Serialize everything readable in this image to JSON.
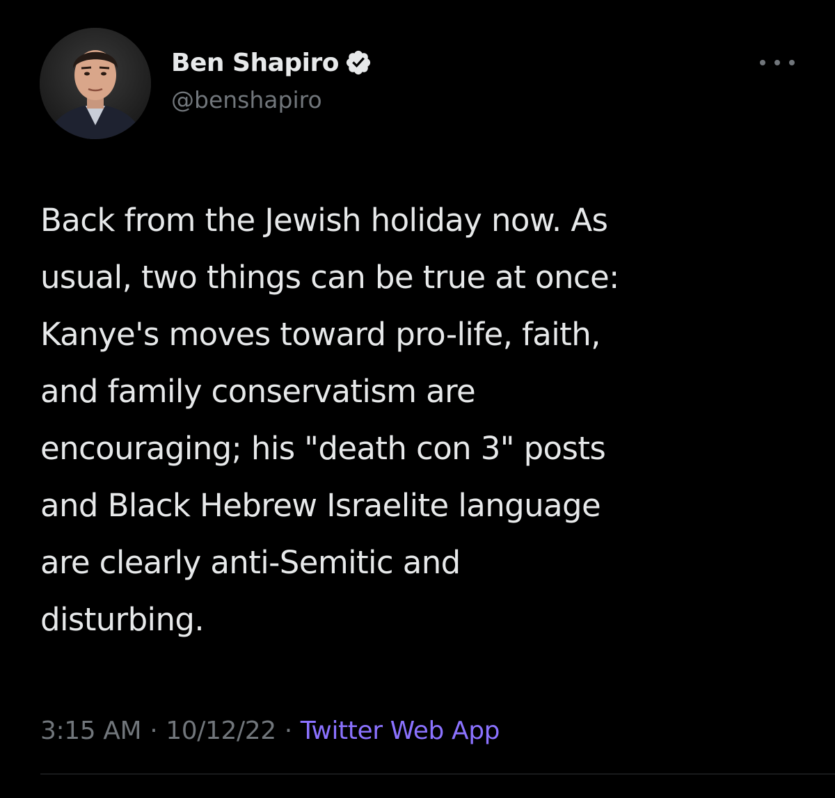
{
  "theme": {
    "background": "#000000",
    "text": "#e7e9ea",
    "muted": "#71767b",
    "link": "#8b72ff",
    "verified_badge": "#e7e9ea"
  },
  "author": {
    "display_name": "Ben Shapiro",
    "handle": "@benshapiro",
    "verified": true,
    "avatar_icon": "profile-photo"
  },
  "tweet": {
    "text": "Back from the Jewish holiday now. As\nusual, two things can be true at once:\nKanye's moves toward pro-life, faith,\nand family conservatism are\nencouraging; his \"death con 3\" posts\nand Black Hebrew Israelite language\nare clearly anti-Semitic and\ndisturbing."
  },
  "meta": {
    "time": "3:15 AM",
    "separator": "·",
    "date": "10/12/22",
    "source": "Twitter Web App"
  },
  "icons": {
    "more": "more-horizontal-icon",
    "verified": "verified-badge-icon"
  }
}
